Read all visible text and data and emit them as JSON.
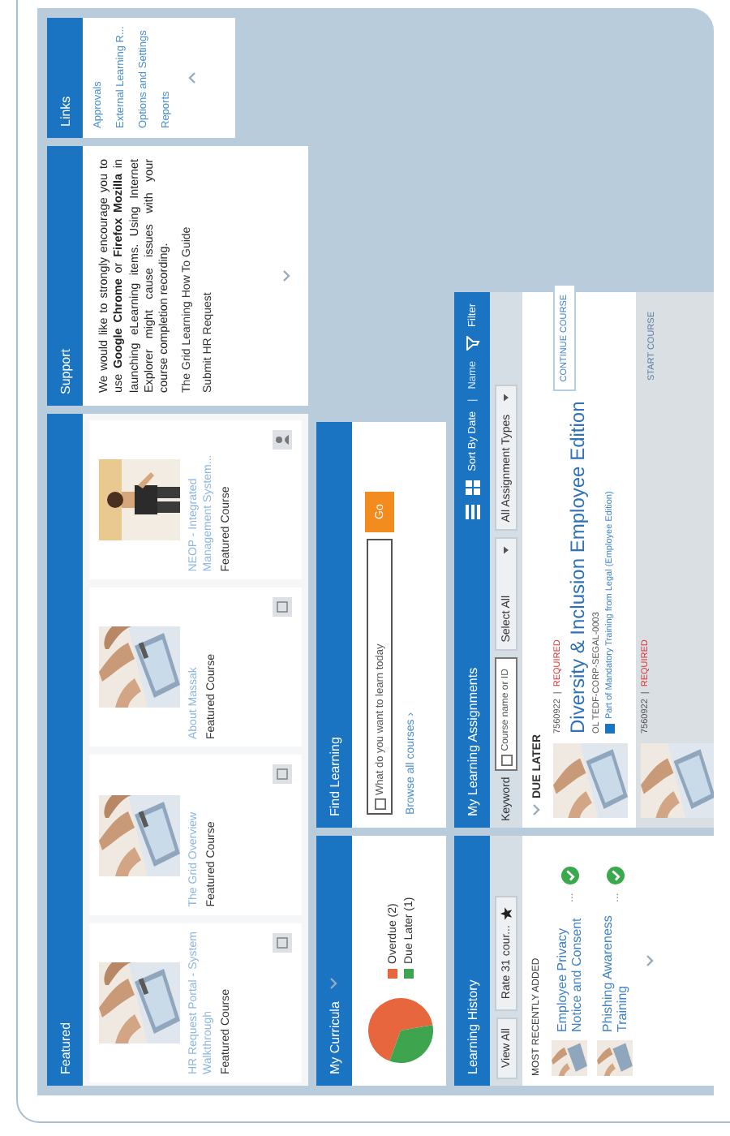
{
  "featured": {
    "title": "Featured",
    "cards": [
      {
        "title": "HR Request Portal - System Walkthrough",
        "subtitle": "Featured Course"
      },
      {
        "title": "The Grid Overview",
        "subtitle": "Featured Course"
      },
      {
        "title": "About Massak",
        "subtitle": "Featured Course"
      },
      {
        "title": "NEOP - Integrated Management System...",
        "subtitle": "Featured Course"
      }
    ]
  },
  "support": {
    "title": "Support",
    "message": "We would like to strongly encourage you to use **Google Chrome** or **Firefox Mozilla** in launching eLearning items. Using Internet Explorer might cause issues with your course completion recording.",
    "links": [
      "The Grid Learning How To Guide",
      "Submit HR Request"
    ]
  },
  "links": {
    "title": "Links",
    "items": [
      "Approvals",
      "External Learning R...",
      "Options and Settings",
      "Reports"
    ]
  },
  "curricula": {
    "title": "My Curricula",
    "legend": [
      {
        "label": "Overdue (2)",
        "color": "#e8663d"
      },
      {
        "label": "Due Later (1)",
        "color": "#3ea44e"
      }
    ],
    "chart_data": {
      "type": "pie",
      "values": [
        66.7,
        33.3
      ]
    }
  },
  "find_learning": {
    "title": "Find Learning",
    "search": {
      "placeholder": "What do you want to learn today"
    },
    "go_button": "Go",
    "browse_link": "Browse all courses ›"
  },
  "learning_history": {
    "title": "Learning History",
    "view_all": "View All",
    "rate_dropdown": "Rate 31 cour...",
    "section": "MOST RECENTLY ADDED",
    "items": [
      {
        "title": "Employee Privacy Notice and Consent",
        "more": "...",
        "completed": true
      },
      {
        "title": "Phishing Awareness Training",
        "more": "...",
        "completed": true
      }
    ]
  },
  "assignments": {
    "title": "My Learning Assignments",
    "sort": "Sort By Date",
    "separator": "|",
    "sort_alt": "Name",
    "filter": "Filter",
    "keyword_label": "Keyword",
    "keyword_field": {
      "placeholder": "Course name or ID"
    },
    "scope_dropdown": "Select All",
    "type_dropdown": "All Assignment Types",
    "section": "DUE LATER",
    "items": [
      {
        "number": "7560922",
        "separator": "|",
        "tag": "REQUIRED",
        "title": "Diversity & Inclusion Employee Edition",
        "code": "OL TEDF-CORP-SEGAL-0003",
        "part_of": "Part of Mandatory Training from Legal (Employee Edition)",
        "action": "CONTINUE COURSE",
        "disabled": false
      },
      {
        "number": "7560922",
        "separator": "|",
        "tag": "REQUIRED",
        "action": "START COURSE",
        "disabled": true
      }
    ]
  }
}
